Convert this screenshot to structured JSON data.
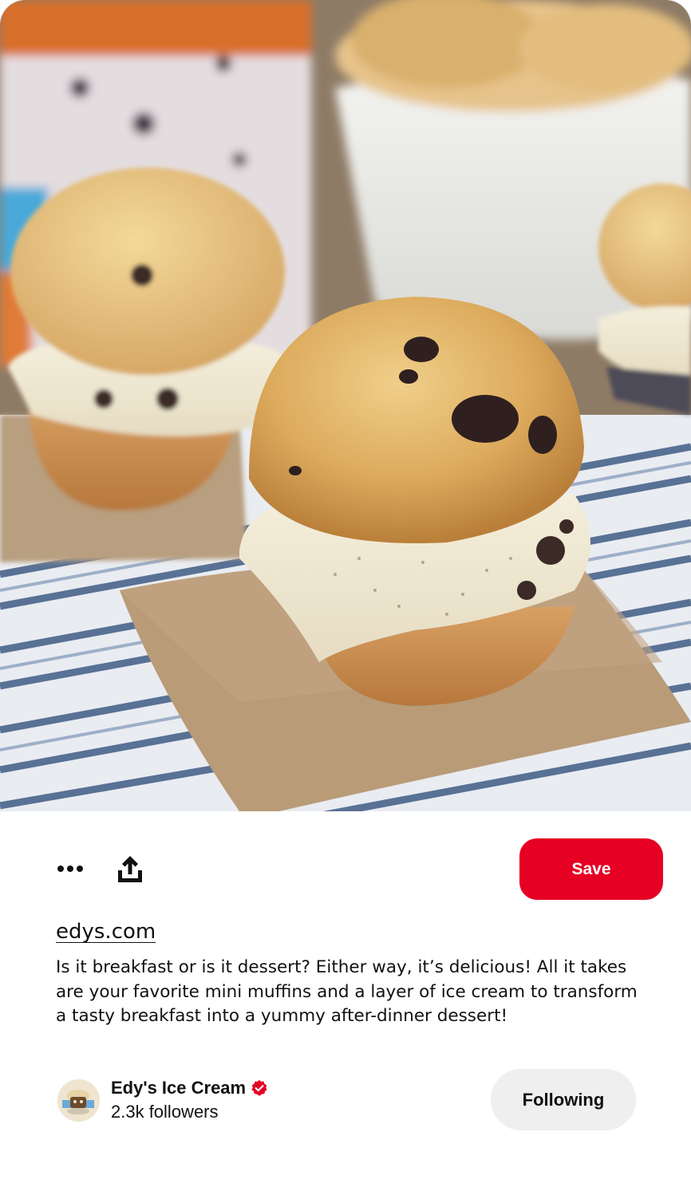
{
  "pin": {
    "image_alt": "Mini muffin ice cream sandwich with cookies and cream ice cream on kraft paper",
    "source_domain": "edys.com",
    "description": "Is it breakfast or is it dessert? Either way, it’s delicious! All it takes are your favorite mini muffins and a layer of ice cream to transform a tasty breakfast into a yummy after-dinner dessert!"
  },
  "actions": {
    "more_icon": "more-horizontal-icon",
    "share_icon": "share-upload-icon",
    "save_label": "Save"
  },
  "creator": {
    "name": "Edy's Ice Cream",
    "followers": "2.3k followers",
    "follow_label": "Following",
    "verified_icon": "verified-check-icon"
  },
  "colors": {
    "brand_red": "#e60023",
    "following_bg": "#efefef",
    "text": "#111111"
  }
}
